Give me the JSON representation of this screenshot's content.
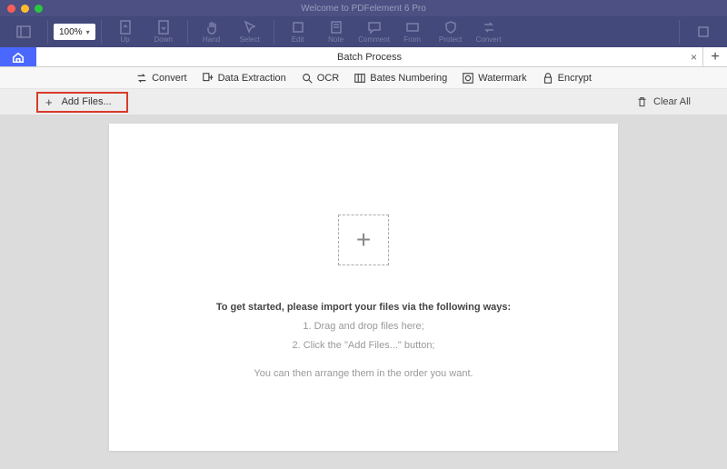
{
  "window": {
    "title": "Welcome to PDFelement 6 Pro"
  },
  "zoom": {
    "value": "100%"
  },
  "ribbon": {
    "btn1": "",
    "btn_up": "Up",
    "btn_down": "Down",
    "btn_hand": "Hand",
    "btn_select": "Select",
    "btn_edit": "Edit",
    "btn_note": "Note",
    "btn_comment": "Comment",
    "btn_from": "From",
    "btn_protect": "Protect",
    "btn_convert": "Convert",
    "btn_right": ""
  },
  "tabs": {
    "doc_title": "Batch Process",
    "close": "×",
    "plus": "+"
  },
  "categories": {
    "convert": "Convert",
    "data_extraction": "Data Extraction",
    "ocr": "OCR",
    "bates": "Bates Numbering",
    "watermark": "Watermark",
    "encrypt": "Encrypt"
  },
  "actions": {
    "add_files": "Add Files...",
    "plus": "+",
    "clear_all": "Clear All"
  },
  "dropzone": {
    "plus": "+",
    "heading": "To get started, please import your files via the following ways:",
    "line1": "1. Drag and drop files here;",
    "line2": "2. Click the \"Add Files...\" button;",
    "note": "You can then arrange them in the order you want."
  }
}
